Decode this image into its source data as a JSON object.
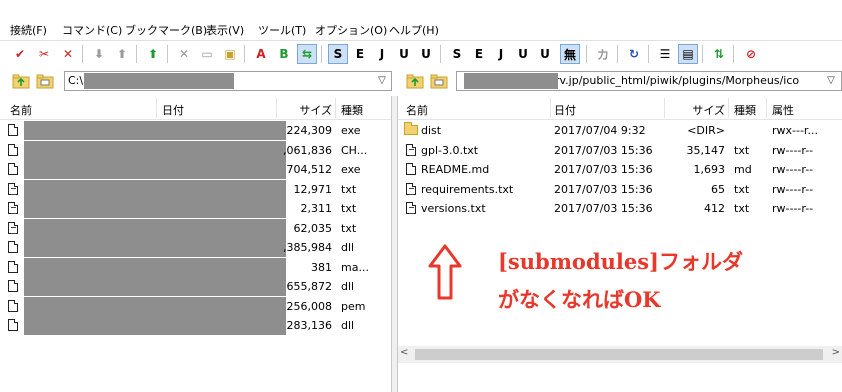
{
  "menu": {
    "items": [
      "接続(F)",
      "コマンド(C)",
      "ブックマーク(B)",
      "表示(V)",
      "ツール(T)",
      "オプション(O)",
      "ヘルプ(H)"
    ]
  },
  "toolbar": {
    "glyphs": {
      "connect": "✔",
      "disconnect": "✂",
      "cancel": "✕",
      "download": "⬇",
      "upload": "⬆",
      "parent": "⬆",
      "delete": "✕",
      "rename": "▭",
      "mkdir": "▣",
      "ascii": "A",
      "binary": "B",
      "auto": "⇆",
      "sjis1": "S",
      "euc1": "E",
      "jis1": "J",
      "utf8n1": "U",
      "utf8bom1": "U",
      "sjis2": "S",
      "euc2": "E",
      "jis2": "J",
      "utf8n2": "U",
      "utf8bom2": "U",
      "nokanji": "無",
      "kana": "カ",
      "refresh": "↻",
      "list": "☰",
      "detail": "▤",
      "sync": "⇅",
      "stop": "⊘"
    },
    "colors": {
      "red": "#d42020",
      "green": "#1e9b2e",
      "blue": "#2050c0",
      "gray": "#9a9a9a"
    }
  },
  "local": {
    "path": "C:\\",
    "columns": {
      "name": "名前",
      "date": "日付",
      "size": "サイズ",
      "type": "種類"
    },
    "files": [
      {
        "size": "224,309",
        "type": "exe",
        "icon": "file"
      },
      {
        "size": ",061,836",
        "type": "CH...",
        "icon": "file"
      },
      {
        "size": "704,512",
        "type": "exe",
        "icon": "file"
      },
      {
        "size": "12,971",
        "type": "txt",
        "icon": "text"
      },
      {
        "size": "2,311",
        "type": "txt",
        "icon": "text"
      },
      {
        "size": "62,035",
        "type": "txt",
        "icon": "text"
      },
      {
        "size": ",385,984",
        "type": "dll",
        "icon": "file"
      },
      {
        "size": "381",
        "type": "ma...",
        "icon": "file"
      },
      {
        "size": "655,872",
        "type": "dll",
        "icon": "file"
      },
      {
        "size": "256,008",
        "type": "pem",
        "icon": "file"
      },
      {
        "size": "283,136",
        "type": "dll",
        "icon": "file"
      }
    ]
  },
  "remote": {
    "path": "rv.jp/public_html/piwik/plugins/Morpheus/ico",
    "columns": {
      "name": "名前",
      "date": "日付",
      "size": "サイズ",
      "type": "種類",
      "attr": "属性"
    },
    "files": [
      {
        "name": "dist",
        "date": "2017/07/04  9:32",
        "size": "<DIR>",
        "type": "",
        "attr": "rwx---r...",
        "icon": "folder"
      },
      {
        "name": "gpl-3.0.txt",
        "date": "2017/07/03 15:36",
        "size": "35,147",
        "type": "txt",
        "attr": "rw----r--",
        "icon": "text"
      },
      {
        "name": "README.md",
        "date": "2017/07/03 15:36",
        "size": "1,693",
        "type": "md",
        "attr": "rw----r--",
        "icon": "file"
      },
      {
        "name": "requirements.txt",
        "date": "2017/07/03 15:36",
        "size": "65",
        "type": "txt",
        "attr": "rw----r--",
        "icon": "text"
      },
      {
        "name": "versions.txt",
        "date": "2017/07/03 15:36",
        "size": "412",
        "type": "txt",
        "attr": "rw----r--",
        "icon": "text"
      }
    ]
  },
  "annotation": {
    "line1": "[submodules]フォルダ",
    "line2": "がなくなればOK",
    "color": "#e8372b"
  }
}
